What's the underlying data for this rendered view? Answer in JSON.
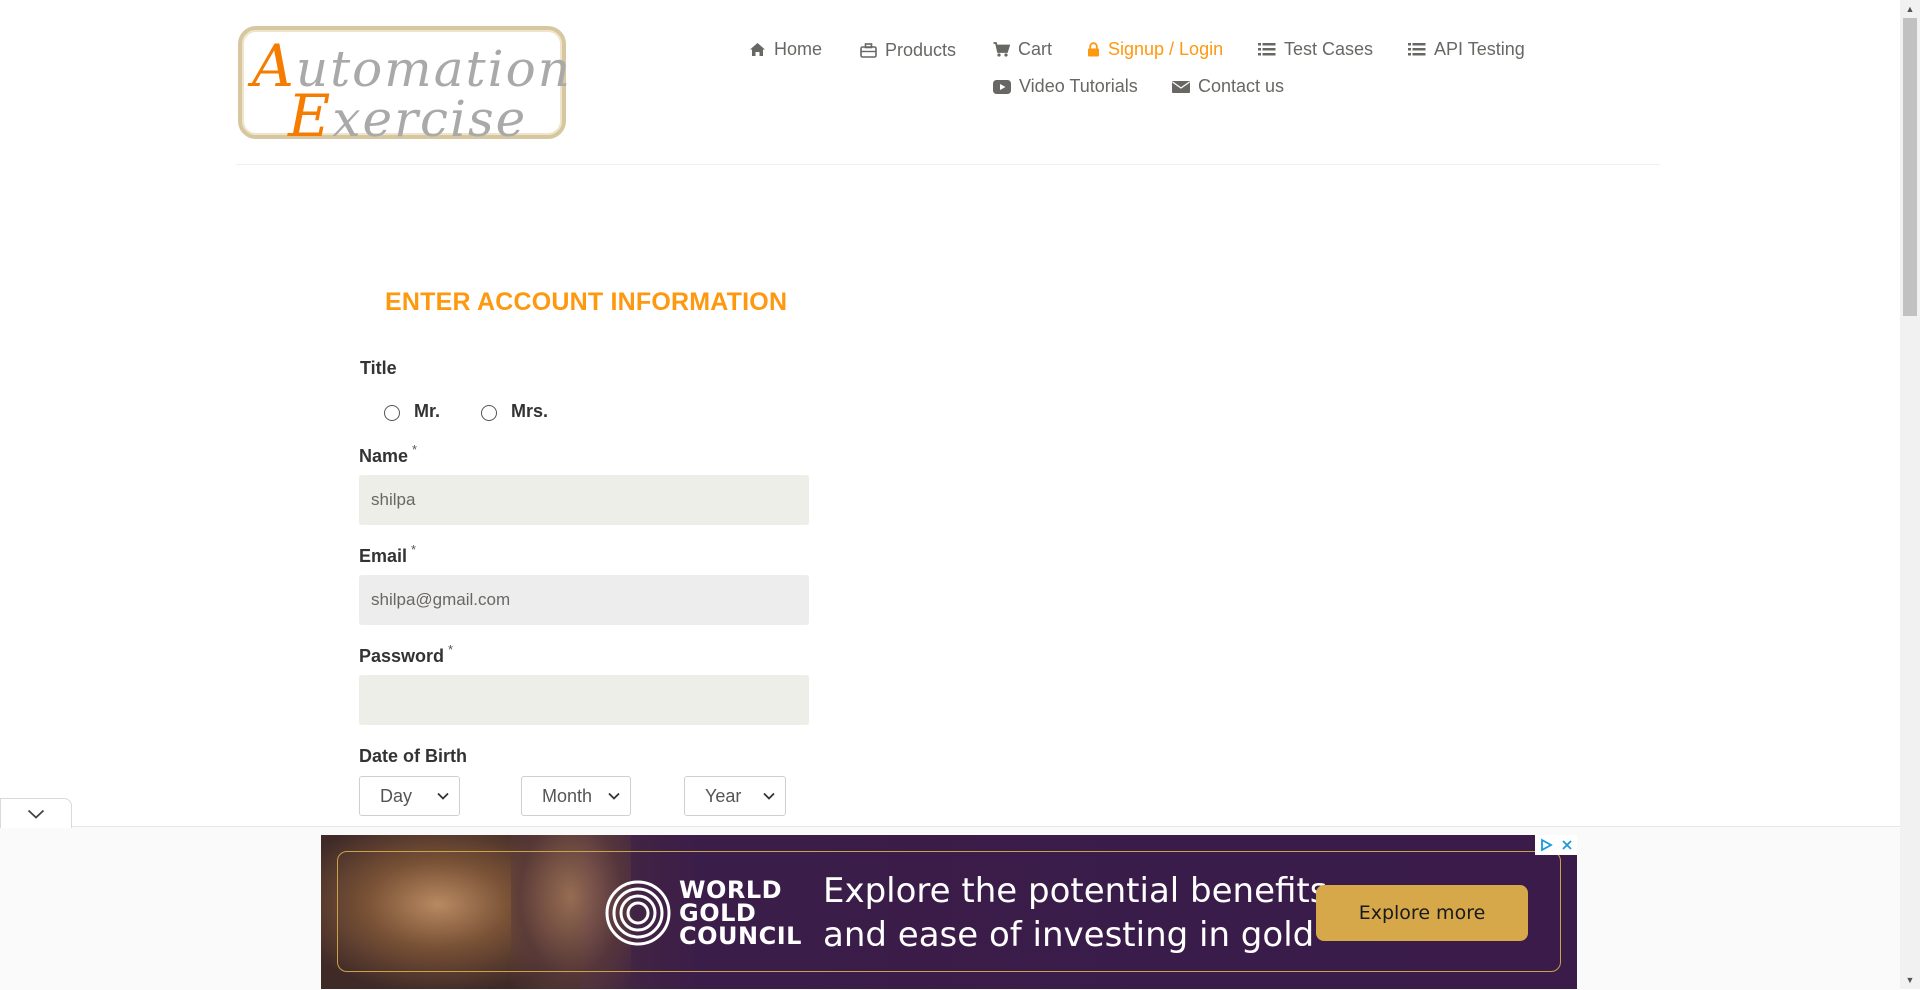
{
  "header": {
    "logo": {
      "line1_cap": "A",
      "line1_rest": "utomation",
      "line2_cap": "E",
      "line2_rest": "xercise"
    },
    "nav": [
      {
        "label": "Home",
        "icon": "home-icon"
      },
      {
        "label": "Products",
        "icon": "briefcase-icon"
      },
      {
        "label": "Cart",
        "icon": "cart-icon"
      },
      {
        "label": "Signup / Login",
        "icon": "lock-icon",
        "active": true
      },
      {
        "label": "Test Cases",
        "icon": "list-icon"
      },
      {
        "label": "API Testing",
        "icon": "list-icon"
      },
      {
        "label": "Video Tutorials",
        "icon": "youtube-play-icon"
      },
      {
        "label": "Contact us",
        "icon": "envelope-icon"
      }
    ],
    "accent_color": "#FE980F"
  },
  "form": {
    "heading": "ENTER ACCOUNT INFORMATION",
    "title_label": "Title",
    "title_options": [
      "Mr.",
      "Mrs."
    ],
    "name": {
      "label": "Name",
      "required_mark": "*",
      "value": "shilpa"
    },
    "email": {
      "label": "Email",
      "required_mark": "*",
      "value": "shilpa@gmail.com"
    },
    "password": {
      "label": "Password",
      "required_mark": "*",
      "value": ""
    },
    "dob": {
      "label": "Date of Birth",
      "day": "Day",
      "month": "Month",
      "year": "Year"
    }
  },
  "ad": {
    "brand_lines": [
      "WORLD",
      "GOLD",
      "COUNCIL"
    ],
    "headline_lines": [
      "Explore the potential benefits",
      "and ease of investing in gold"
    ],
    "cta": "Explore more",
    "colors": {
      "background": "#3a1b4a",
      "gold": "#d6a84a"
    }
  }
}
